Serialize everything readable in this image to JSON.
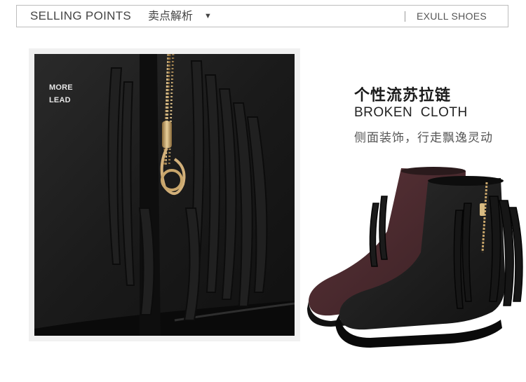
{
  "header": {
    "title_en": "SELLING POINTS",
    "title_cn": "卖点解析",
    "caret_icon": "caret-down-icon",
    "brand": "EXULL SHOES"
  },
  "detail_photo": {
    "overlay_line1": "MORE",
    "overlay_line2": "LEAD"
  },
  "feature": {
    "title": "个性流苏拉链",
    "subtitle": "BROKEN  CLOTH",
    "description": "侧面装饰，行走飘逸灵动"
  },
  "colors": {
    "border": "#bdbdbd",
    "boot_black": "#1c1c1c",
    "boot_burgundy": "#4a2a2e",
    "zipper_gold": "#c9a66b"
  }
}
